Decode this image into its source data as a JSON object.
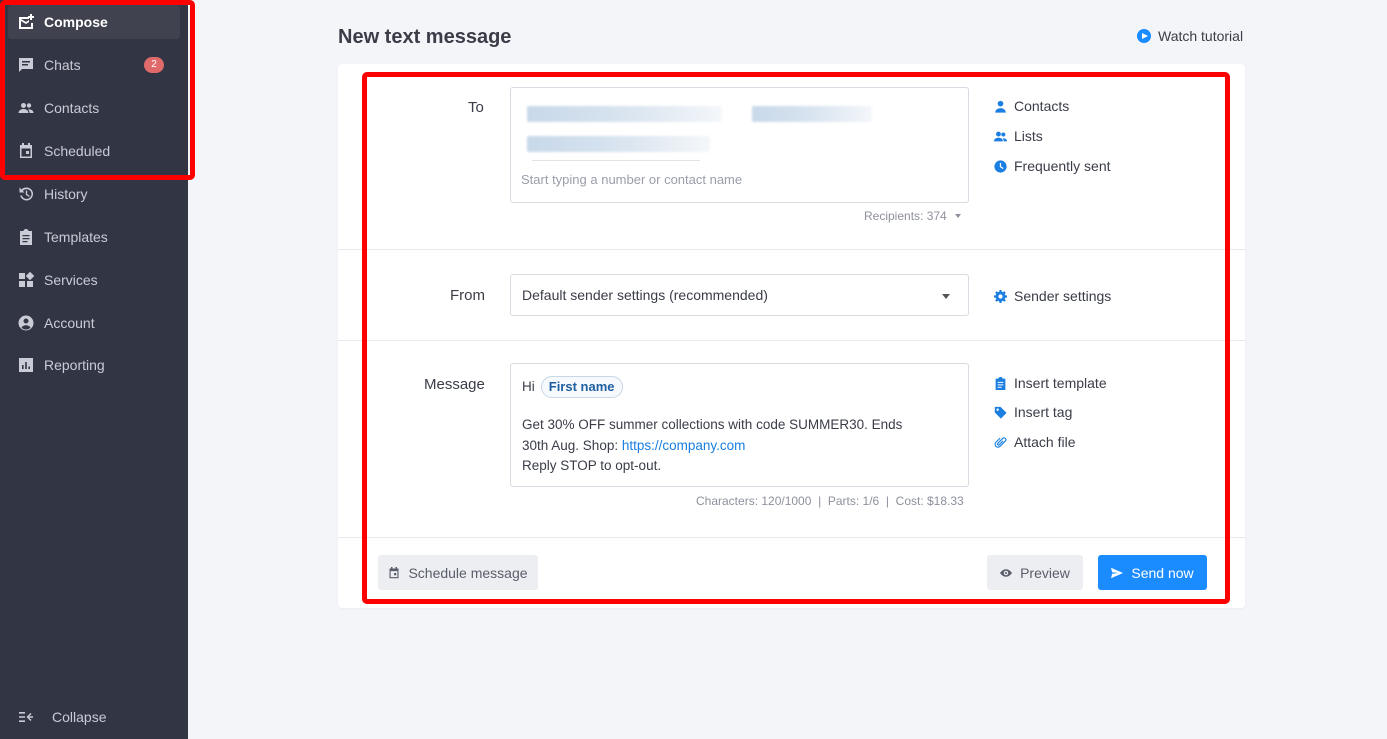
{
  "sidebar": {
    "items": [
      {
        "label": "Compose",
        "icon": "compose-icon",
        "active": true
      },
      {
        "label": "Chats",
        "icon": "chat-icon",
        "badge": "2"
      },
      {
        "label": "Contacts",
        "icon": "contacts-icon"
      },
      {
        "label": "Scheduled",
        "icon": "calendar-icon"
      },
      {
        "label": "History",
        "icon": "history-icon"
      },
      {
        "label": "Templates",
        "icon": "clipboard-icon"
      },
      {
        "label": "Services",
        "icon": "grid-icon"
      },
      {
        "label": "Account",
        "icon": "account-icon"
      },
      {
        "label": "Reporting",
        "icon": "chart-icon"
      }
    ],
    "collapse_label": "Collapse"
  },
  "header": {
    "title": "New text message",
    "tutorial_label": "Watch tutorial"
  },
  "to": {
    "label": "To",
    "placeholder": "Start typing a number or contact name",
    "recipients": "Recipients: 374",
    "links": [
      "Contacts",
      "Lists",
      "Frequently sent"
    ]
  },
  "from": {
    "label": "From",
    "selected": "Default sender settings (recommended)",
    "link": "Sender settings"
  },
  "message": {
    "label": "Message",
    "greeting": "Hi",
    "tag": "First name",
    "body_line1": "Get 30% OFF summer collections with code SUMMER30. Ends",
    "body_line2_prefix": "30th Aug. Shop: ",
    "body_link": "https://company.com",
    "body_line3": "Reply STOP to opt-out.",
    "stats": "Characters: 120/1000  |  Parts: 1/6  |  Cost: $18.33",
    "links": [
      "Insert template",
      "Insert tag",
      "Attach file"
    ]
  },
  "footer": {
    "schedule_label": "Schedule message",
    "preview_label": "Preview",
    "send_label": "Send now"
  },
  "colors": {
    "sidebar_bg": "#323544",
    "accent": "#1a8cff",
    "highlight": "#ff0000",
    "badge": "#e06a6a"
  }
}
